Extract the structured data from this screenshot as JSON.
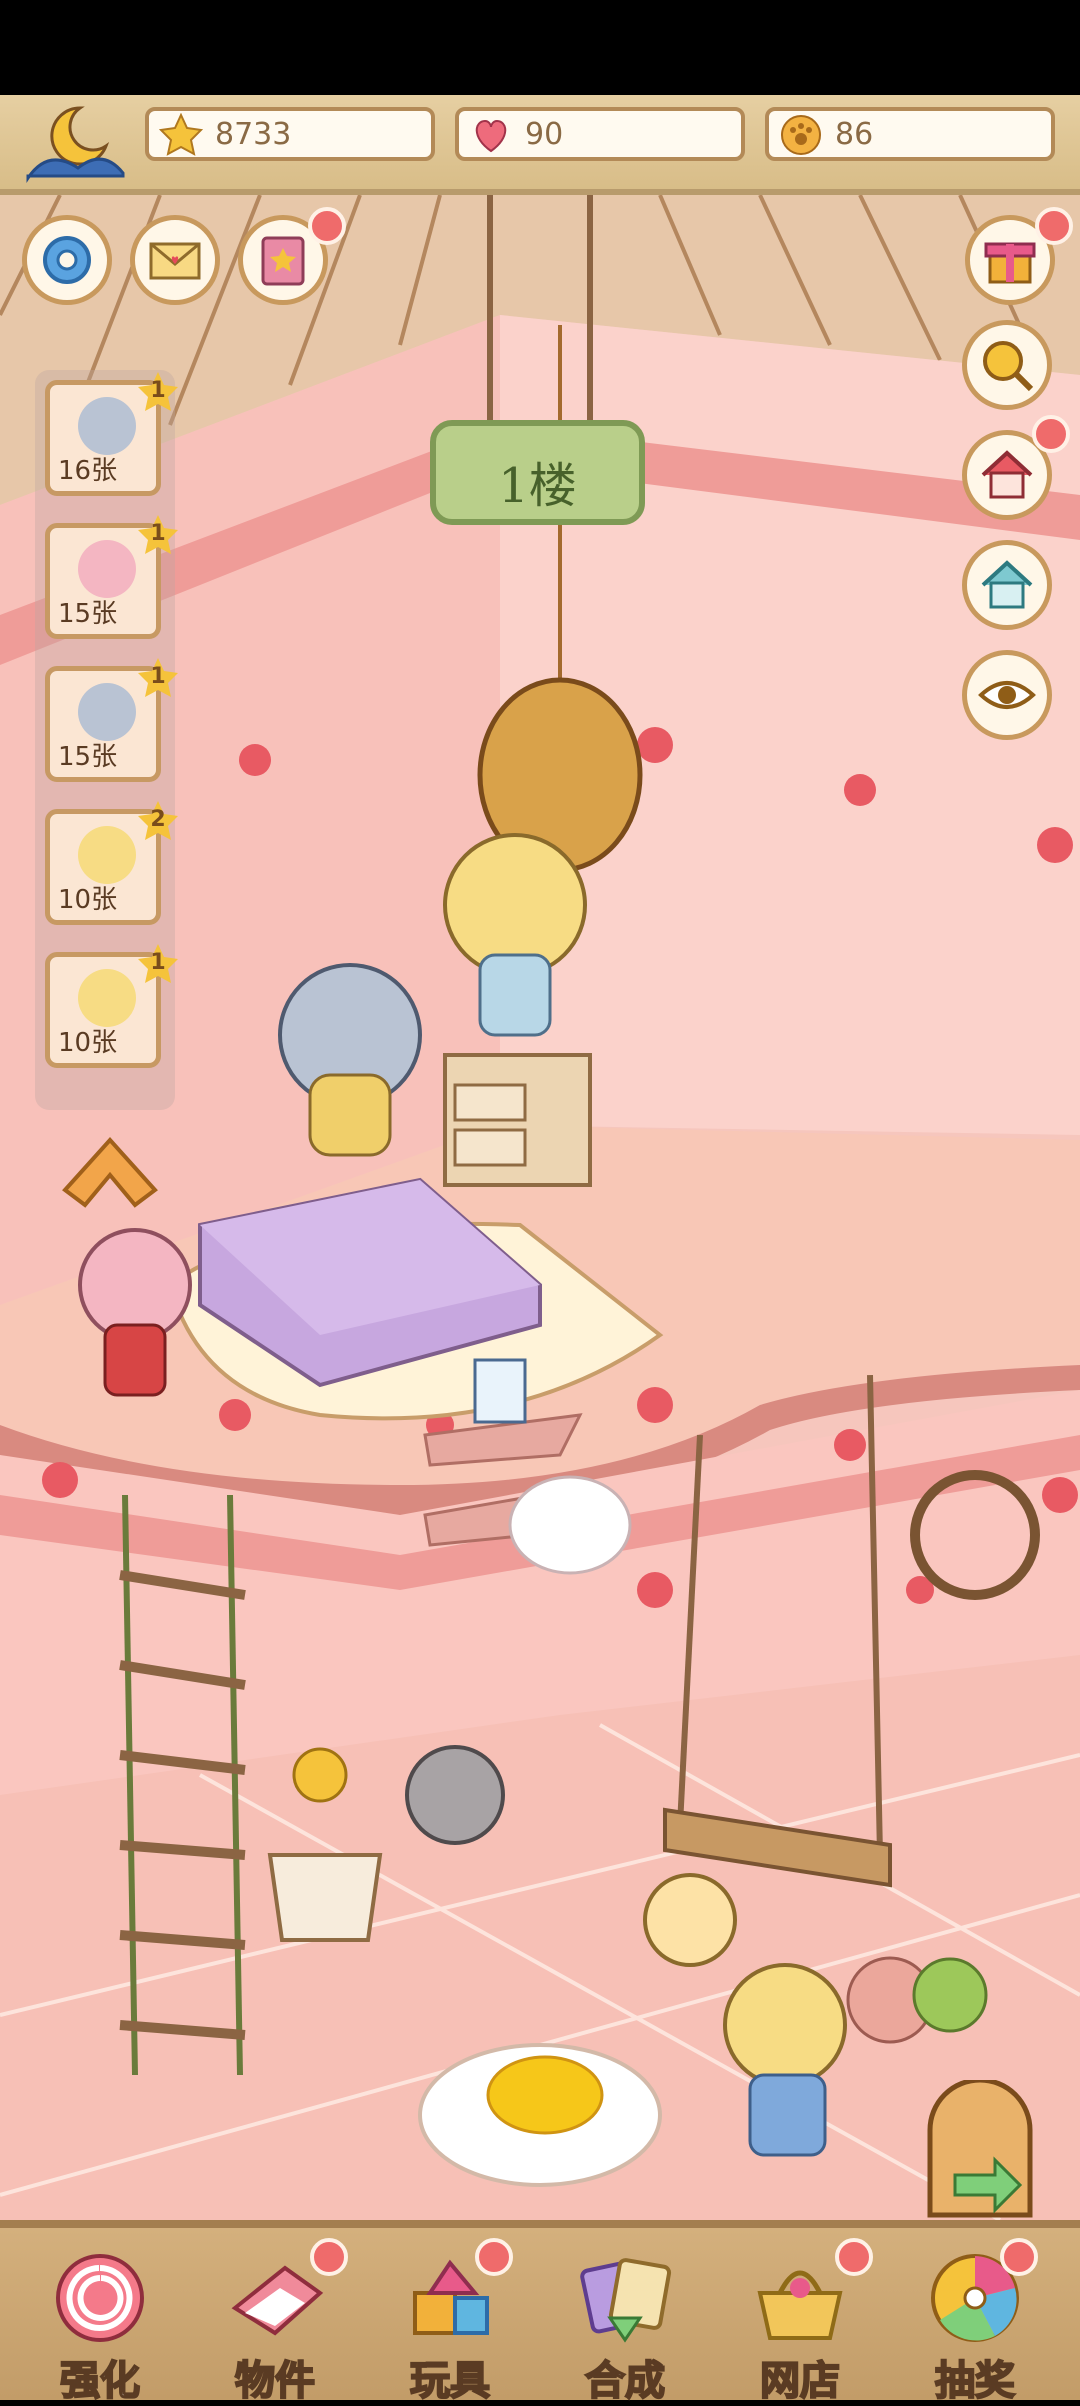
{
  "resources": {
    "stars": "8733",
    "hearts": "90",
    "paws": "86"
  },
  "floor_sign": "1楼",
  "side_cards": [
    {
      "count": "16张",
      "badge": "1"
    },
    {
      "count": "15张",
      "badge": "1"
    },
    {
      "count": "15张",
      "badge": "1"
    },
    {
      "count": "10张",
      "badge": "2"
    },
    {
      "count": "10张",
      "badge": "1"
    }
  ],
  "nav": {
    "enhance": "强化",
    "items": "物件",
    "toys": "玩具",
    "merge": "合成",
    "shop": "网店",
    "lottery": "抽奖"
  },
  "colors": {
    "notification": "#ef6b6b",
    "wall": "#f6c6bd",
    "frame": "#c8995d"
  }
}
